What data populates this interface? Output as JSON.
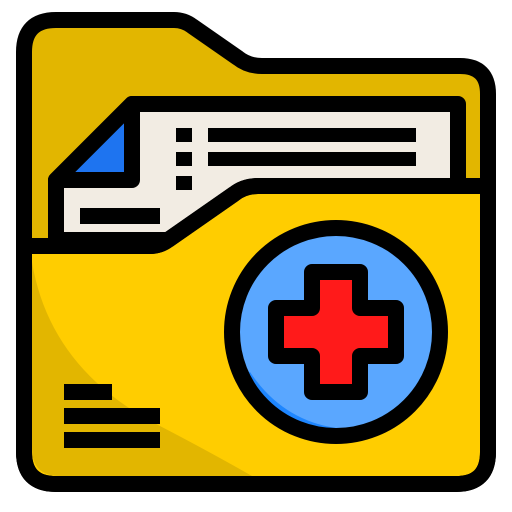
{
  "icon": {
    "name": "medical-folder-icon",
    "parts": [
      "folder-back",
      "document",
      "folder-front",
      "add-badge",
      "text-lines"
    ]
  },
  "colors": {
    "outline": "#000000",
    "folder_back": "#E2B600",
    "folder_front": "#FFCD00",
    "folder_shadow": "#E2B600",
    "paper": "#F2ECE3",
    "paper_fold": "#1E74F0",
    "badge": "#5AA7FF",
    "badge_shadow": "#1E86FF",
    "cross": "#FF1A1A"
  }
}
